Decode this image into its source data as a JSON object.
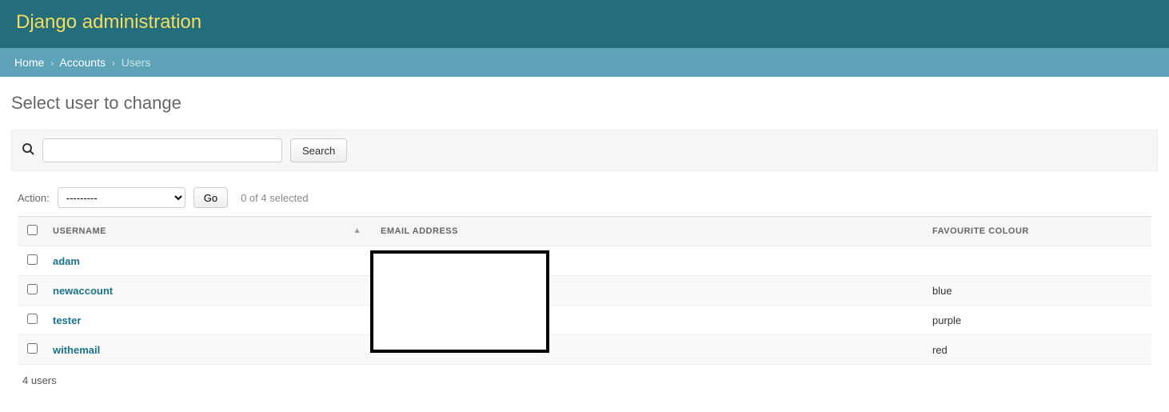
{
  "header": {
    "title": "Django administration"
  },
  "breadcrumbs": {
    "items": [
      {
        "label": "Home"
      },
      {
        "label": "Accounts"
      }
    ],
    "current": "Users",
    "sep": "›"
  },
  "page": {
    "title": "Select user to change"
  },
  "search": {
    "button_label": "Search",
    "value": "",
    "placeholder": ""
  },
  "actions": {
    "label": "Action:",
    "selected_option": "---------",
    "go_label": "Go",
    "selection_text": "0 of 4 selected"
  },
  "table": {
    "columns": {
      "username": "USERNAME",
      "email": "EMAIL ADDRESS",
      "colour": "FAVOURITE COLOUR"
    },
    "rows": [
      {
        "username": "adam",
        "email": "",
        "colour": ""
      },
      {
        "username": "newaccount",
        "email": "",
        "colour": "blue"
      },
      {
        "username": "tester",
        "email": "",
        "colour": "purple"
      },
      {
        "username": "withemail",
        "email": "",
        "colour": "red"
      }
    ]
  },
  "footer": {
    "count_text": "4 users"
  }
}
